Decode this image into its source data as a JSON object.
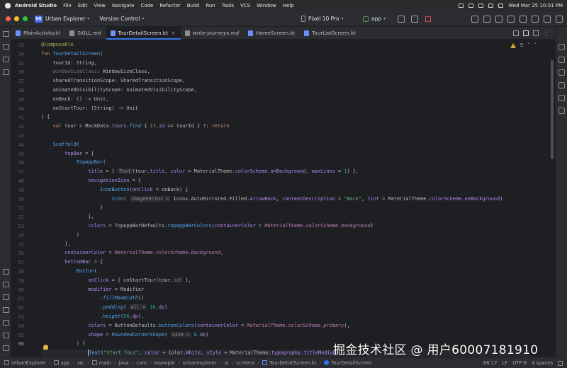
{
  "menubar": {
    "app_name": "Android Studio",
    "items": [
      "File",
      "Edit",
      "View",
      "Navigate",
      "Code",
      "Refactor",
      "Build",
      "Run",
      "Tools",
      "VCS",
      "Window",
      "Help"
    ],
    "datetime": "Wed Mar 25  10:01 PM"
  },
  "toolbar": {
    "project_badge": "UE",
    "project_name": "Urban Explorer",
    "vcs_label": "Version Control",
    "device": "Pixel 10 Pro",
    "run_config": "app"
  },
  "tabs": [
    {
      "label": "MainActivity.kt",
      "icon_color": "#6e8ff7"
    },
    {
      "label": "SKILL.md",
      "icon_color": "#8c8f96"
    },
    {
      "label": "TourDetailScreen.kt",
      "icon_color": "#6e8ff7",
      "active": true
    },
    {
      "label": "write-journeys.md",
      "icon_color": "#8c8f96",
      "italic": true
    },
    {
      "label": "HomeScreen.kt",
      "icon_color": "#6e8ff7"
    },
    {
      "label": "TourListScreen.kt",
      "icon_color": "#6e8ff7"
    }
  ],
  "editor": {
    "inspection_count": "5",
    "line_numbers": [
      "33",
      "34",
      "35",
      "36",
      "37",
      "38",
      "39",
      "40",
      "41",
      "42",
      "43",
      "44",
      "45",
      "46",
      "47",
      "48",
      "49",
      "50",
      "51",
      "52",
      "53",
      "54",
      "55",
      "56",
      "57",
      "58",
      "59",
      "60",
      "61",
      "62",
      "63",
      "64",
      "65",
      "66"
    ],
    "current_line": "66"
  },
  "statusbar": {
    "breadcrumb": [
      "UrbanExplorer",
      "app",
      "src",
      "main",
      "java",
      "com",
      "example",
      "urbanexplorer",
      "ui",
      "screens",
      "TourDetailScreen.kt",
      "TourDetailScreen"
    ],
    "position": "66:17",
    "line_sep": "LF",
    "encoding": "UTF-8",
    "indent": "4 spaces"
  },
  "watermark": "掘金技术社区 @ 用户60007181910",
  "colors": {
    "accent": "#3574f0",
    "keyword": "#cf8e6d",
    "function": "#56a8f5",
    "string": "#6aab73"
  }
}
